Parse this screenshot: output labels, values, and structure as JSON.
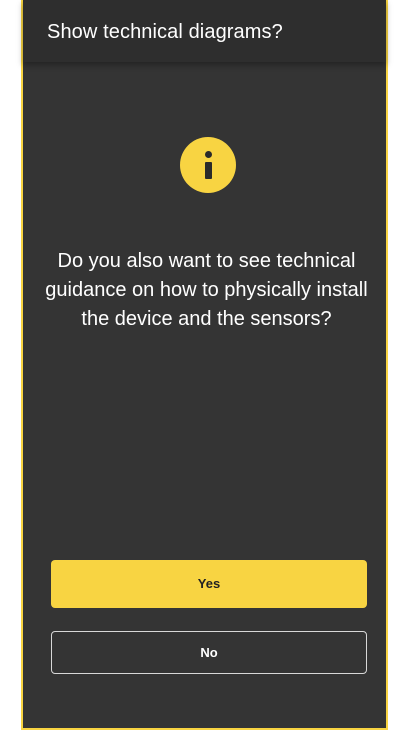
{
  "dialog": {
    "title": "Show technical diagrams?",
    "icon": "info-icon",
    "message": "Do you also want to see technical guidance on how to physically install the device and the sensors?",
    "yes_label": "Yes",
    "no_label": "No"
  },
  "colors": {
    "accent": "#f8d442",
    "background": "#343434",
    "header": "#2e2e2e",
    "text": "#ffffff"
  }
}
